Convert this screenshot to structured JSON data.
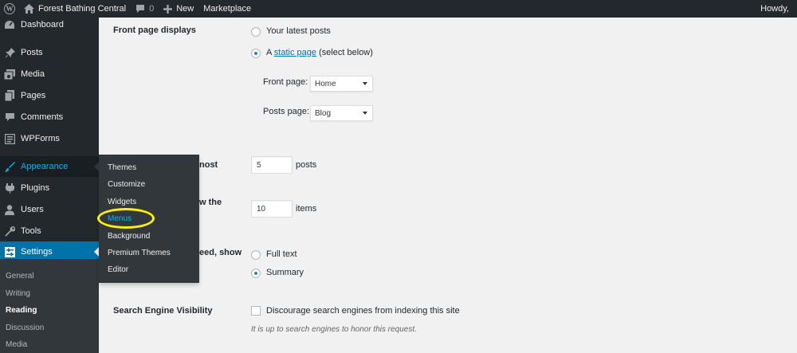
{
  "admin_bar": {
    "site_name": "Forest Bathing Central",
    "comment_count": "0",
    "new_label": "New",
    "marketplace_label": "Marketplace",
    "howdy": "Howdy,"
  },
  "sidebar": {
    "items": [
      {
        "label": "Dashboard",
        "icon": "dashboard-icon"
      },
      {
        "label": "Posts",
        "icon": "pin-icon"
      },
      {
        "label": "Media",
        "icon": "media-icon"
      },
      {
        "label": "Pages",
        "icon": "pages-icon"
      },
      {
        "label": "Comments",
        "icon": "comment-icon"
      },
      {
        "label": "WPForms",
        "icon": "form-icon"
      },
      {
        "label": "Appearance",
        "icon": "brush-icon",
        "state": "hover"
      },
      {
        "label": "Plugins",
        "icon": "plugin-icon"
      },
      {
        "label": "Users",
        "icon": "user-icon"
      },
      {
        "label": "Tools",
        "icon": "wrench-icon"
      },
      {
        "label": "Settings",
        "icon": "settings-icon",
        "state": "current"
      }
    ],
    "settings_submenu": [
      "General",
      "Writing",
      "Reading",
      "Discussion",
      "Media"
    ],
    "settings_submenu_current": "Reading"
  },
  "appearance_flyout": {
    "items": [
      "Themes",
      "Customize",
      "Widgets",
      "Menus",
      "Background",
      "Premium Themes",
      "Editor"
    ],
    "focused": "Menus"
  },
  "reading_settings": {
    "front_page_displays": {
      "label": "Front page displays",
      "option_latest": "Your latest posts",
      "option_static_prefix": "A",
      "option_static_link": "static page",
      "option_static_suffix": "(select below)",
      "selected": "static",
      "front_page_label": "Front page:",
      "front_page_value": "Home",
      "posts_page_label": "Posts page:",
      "posts_page_value": "Blog"
    },
    "blog_pages_show_at_most": {
      "label_visible": "nost",
      "value": "5",
      "unit": "posts"
    },
    "syndication_feeds_show": {
      "label_visible": "w the",
      "value": "10",
      "unit": "items"
    },
    "feed_article_show": {
      "label_visible": "eed, show",
      "option_full": "Full text",
      "option_summary": "Summary",
      "selected": "summary"
    },
    "search_engine_visibility": {
      "label": "Search Engine Visibility",
      "checkbox_label": "Discourage search engines from indexing this site",
      "checked": false,
      "description": "It is up to search engines to honor this request."
    }
  },
  "colors": {
    "admin_dark": "#23282d",
    "submenu_dark": "#32373c",
    "accent_blue": "#0073aa",
    "hover_cyan": "#00b9eb",
    "highlight_yellow": "#fff200"
  }
}
